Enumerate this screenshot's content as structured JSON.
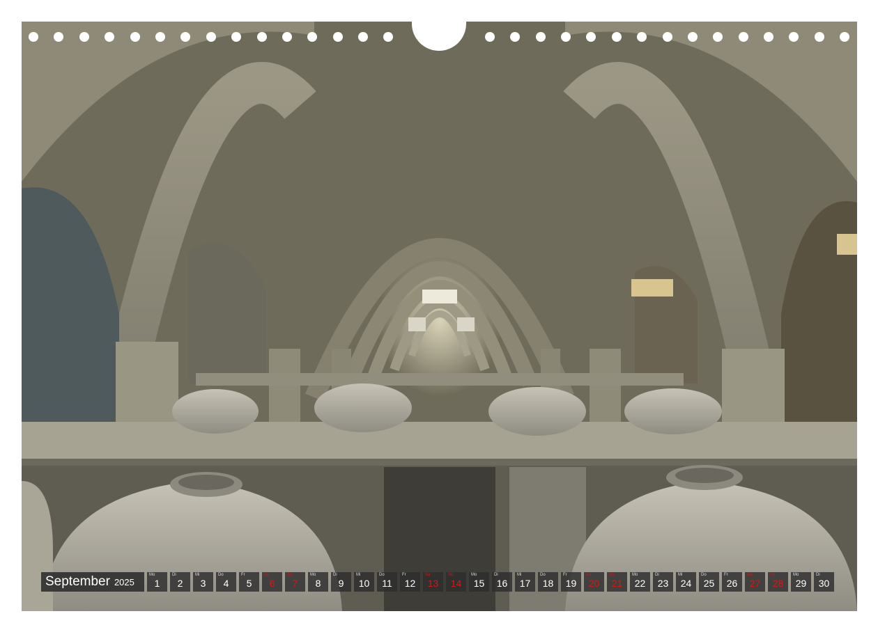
{
  "calendar": {
    "month": "September",
    "year": "2025",
    "days": [
      {
        "wd": "Mo",
        "num": "1",
        "weekend": false
      },
      {
        "wd": "Di",
        "num": "2",
        "weekend": false
      },
      {
        "wd": "Mi",
        "num": "3",
        "weekend": false
      },
      {
        "wd": "Do",
        "num": "4",
        "weekend": false
      },
      {
        "wd": "Fr",
        "num": "5",
        "weekend": false
      },
      {
        "wd": "Sa",
        "num": "6",
        "weekend": true
      },
      {
        "wd": "So",
        "num": "7",
        "weekend": true
      },
      {
        "wd": "Mo",
        "num": "8",
        "weekend": false
      },
      {
        "wd": "Di",
        "num": "9",
        "weekend": false
      },
      {
        "wd": "Mi",
        "num": "10",
        "weekend": false
      },
      {
        "wd": "Do",
        "num": "11",
        "weekend": false
      },
      {
        "wd": "Fr",
        "num": "12",
        "weekend": false
      },
      {
        "wd": "Sa",
        "num": "13",
        "weekend": true
      },
      {
        "wd": "So",
        "num": "14",
        "weekend": true
      },
      {
        "wd": "Mo",
        "num": "15",
        "weekend": false
      },
      {
        "wd": "Di",
        "num": "16",
        "weekend": false
      },
      {
        "wd": "Mi",
        "num": "17",
        "weekend": false
      },
      {
        "wd": "Do",
        "num": "18",
        "weekend": false
      },
      {
        "wd": "Fr",
        "num": "19",
        "weekend": false
      },
      {
        "wd": "Sa",
        "num": "20",
        "weekend": true
      },
      {
        "wd": "So",
        "num": "21",
        "weekend": true
      },
      {
        "wd": "Mo",
        "num": "22",
        "weekend": false
      },
      {
        "wd": "Di",
        "num": "23",
        "weekend": false
      },
      {
        "wd": "Mi",
        "num": "24",
        "weekend": false
      },
      {
        "wd": "Do",
        "num": "25",
        "weekend": false
      },
      {
        "wd": "Fr",
        "num": "26",
        "weekend": false
      },
      {
        "wd": "Sa",
        "num": "27",
        "weekend": true
      },
      {
        "wd": "So",
        "num": "28",
        "weekend": true
      },
      {
        "wd": "Mo",
        "num": "29",
        "weekend": false
      },
      {
        "wd": "Di",
        "num": "30",
        "weekend": false
      }
    ]
  },
  "colors": {
    "weekend": "#d11a1a",
    "cell_bg": "#2d2d2d",
    "paper": "#ffffff"
  },
  "photo": {
    "subject_icon": "cellar-arches-photo"
  }
}
